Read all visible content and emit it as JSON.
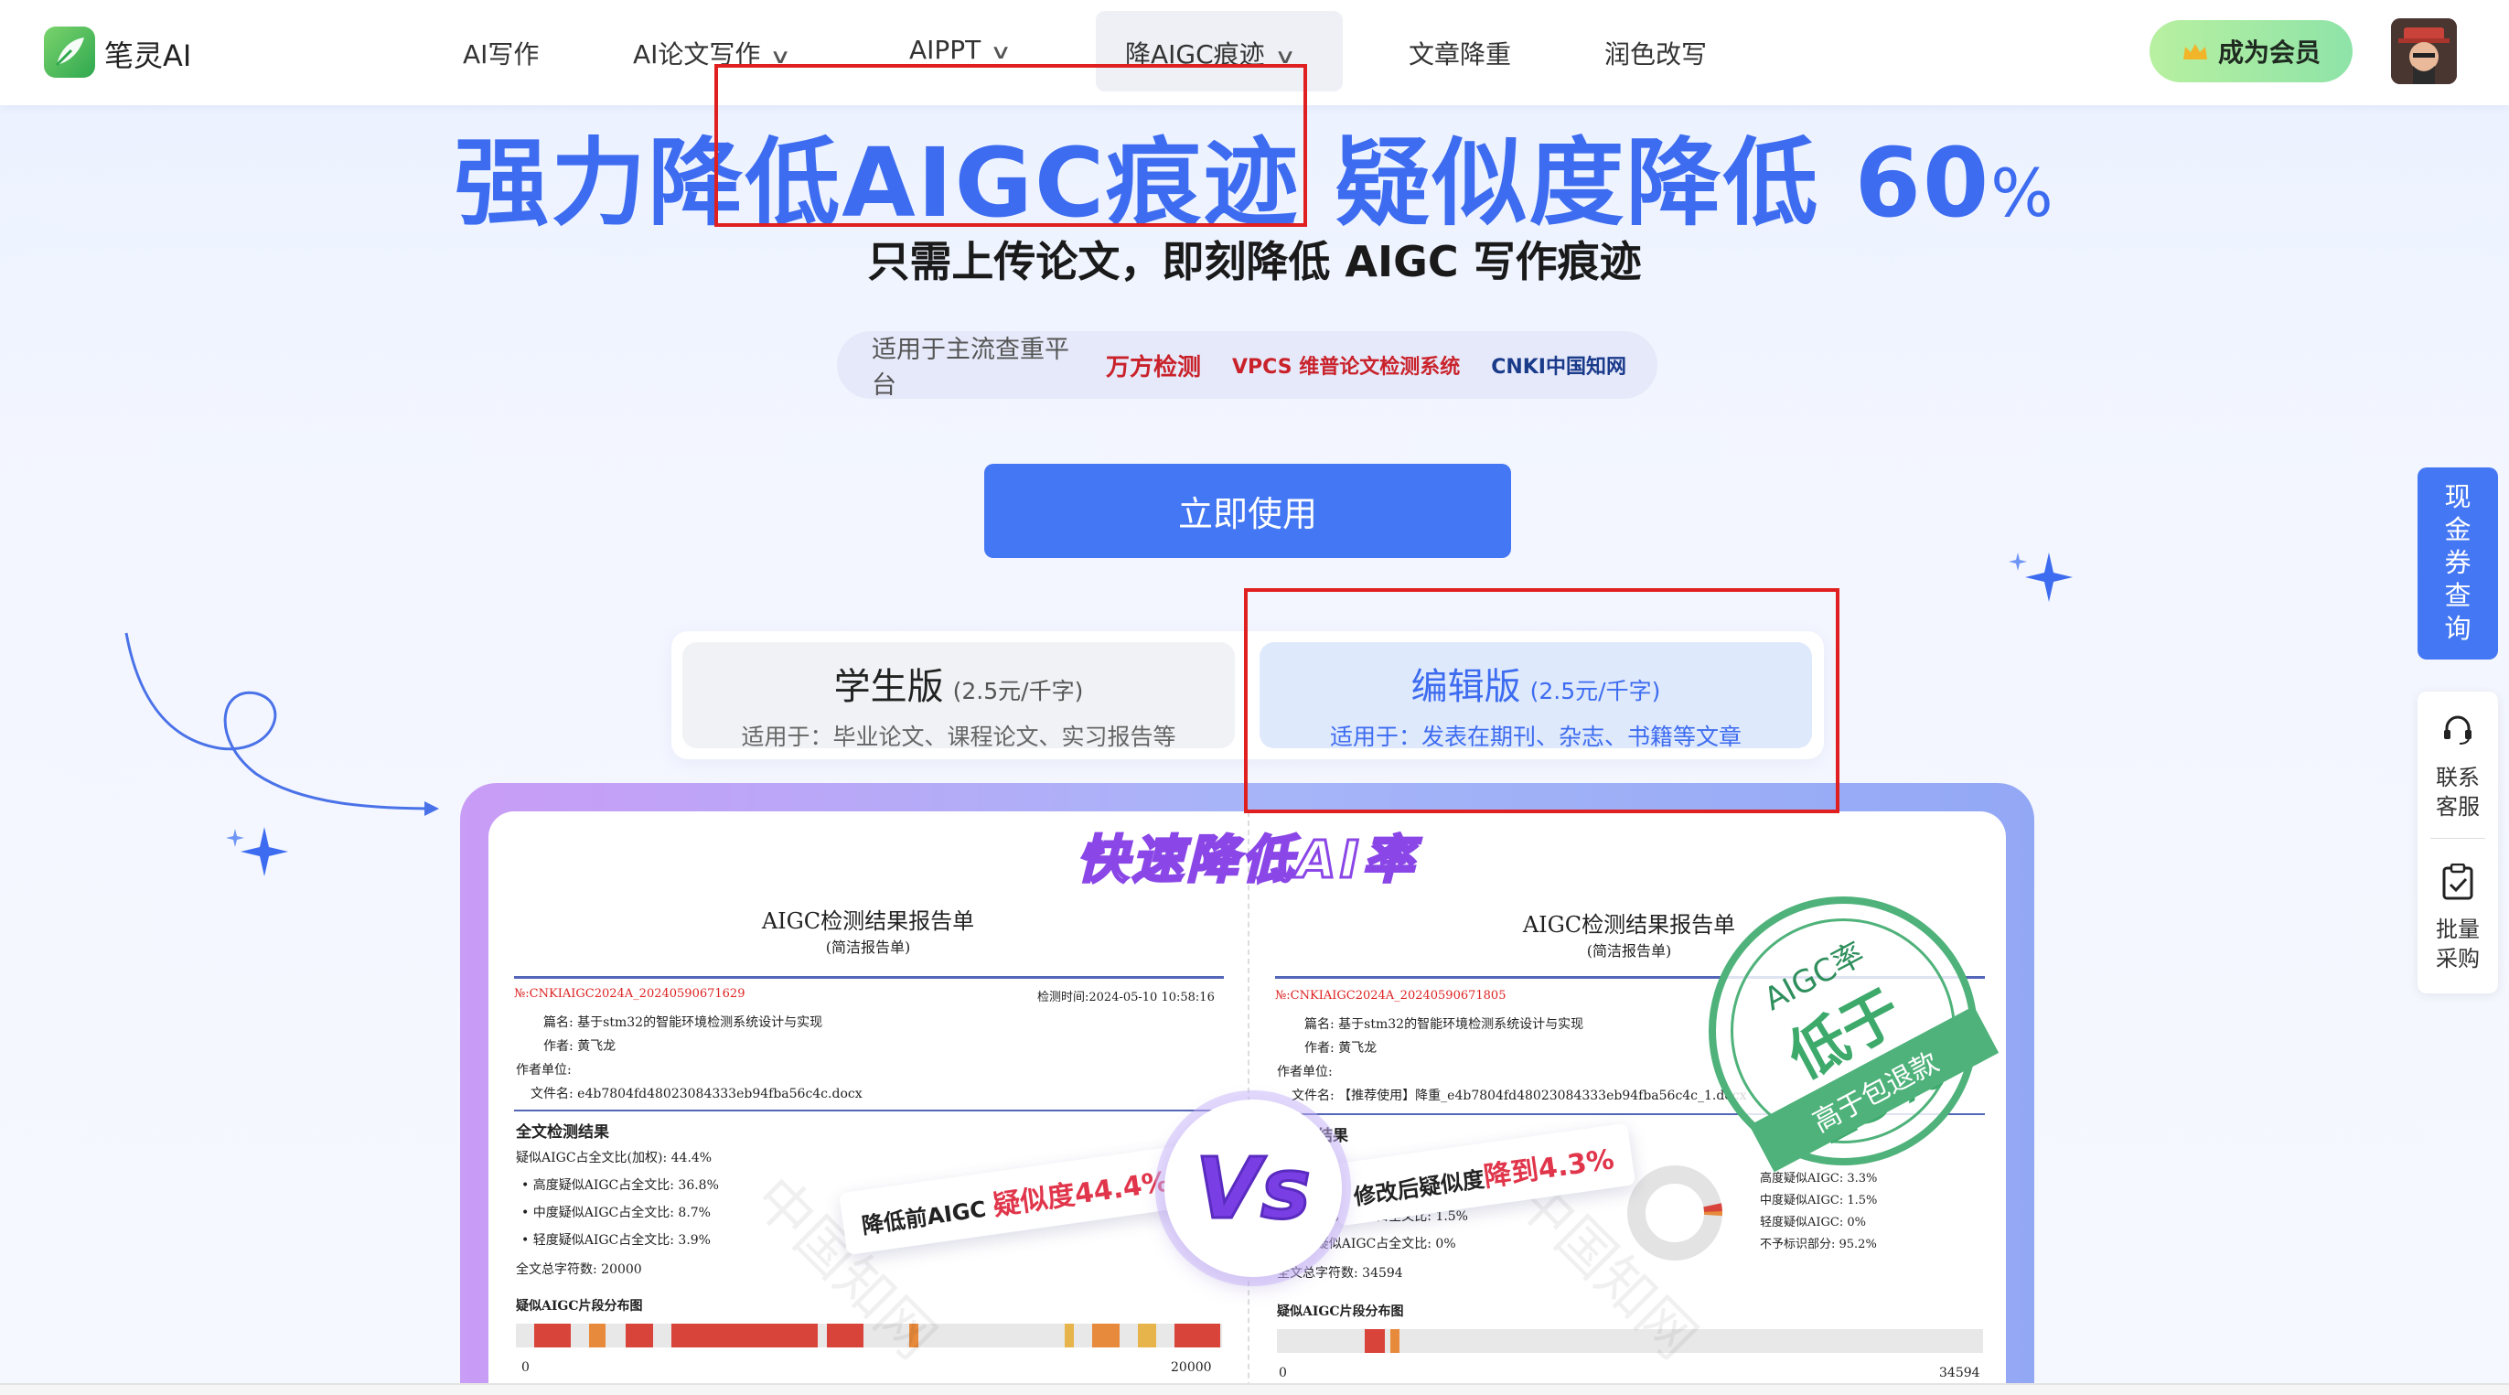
{
  "brand": {
    "name": "笔灵AI"
  },
  "nav": {
    "items": [
      {
        "label": "AI写作",
        "chevron": false
      },
      {
        "label": "AI论文写作",
        "chevron": true
      },
      {
        "label": "AIPPT",
        "chevron": true
      },
      {
        "label": "降AIGC痕迹",
        "chevron": true,
        "active": true
      },
      {
        "label": "文章降重",
        "chevron": false
      },
      {
        "label": "润色改写",
        "chevron": false
      }
    ],
    "member_button": "成为会员"
  },
  "hero": {
    "title_part1": "强力降低AIGC痕迹 疑似度降低 60",
    "title_pct": "%",
    "subtitle": "只需上传论文，即刻降低 AIGC 写作痕迹",
    "platforms_label": "适用于主流查重平台",
    "platforms": [
      "万方检测",
      "VPCS 维普论文检测系统",
      "CNKI中国知网"
    ],
    "cta": "立即使用"
  },
  "versions": [
    {
      "name": "学生版",
      "price": "(2.5元/千字)",
      "desc": "适用于：毕业论文、课程论文、实习报告等",
      "selected": false
    },
    {
      "name": "编辑版",
      "price": "(2.5元/千字)",
      "desc": "适用于：发表在期刊、杂志、书籍等文章",
      "selected": true
    }
  ],
  "showcase": {
    "title": "快速降低AI率",
    "left_report": {
      "title": "AIGC检测结果报告单",
      "subtitle": "(简洁报告单)",
      "no": "№:CNKIAIGC2024A_20240590671629",
      "time": "检测时间:2024-05-10 10:58:16",
      "paper": "篇名: 基于stm32的智能环境检测系统设计与实现",
      "author": "作者: 黄飞龙",
      "unit": "作者单位:",
      "file": "文件名: e4b7804fd48023084333eb94fba56c4c.docx",
      "section": "全文检测结果",
      "lines": [
        "疑似AIGC占全文比(加权): 44.4%",
        "• 高度疑似AIGC占全文比: 36.8%",
        "• 中度疑似AIGC占全文比: 8.7%",
        "• 轻度疑似AIGC占全文比: 3.9%",
        "全文总字符数: 20000"
      ],
      "dist_label": "疑似AIGC片段分布图",
      "axis_start": "0",
      "axis_end": "20000"
    },
    "right_report": {
      "title": "AIGC检测结果报告单",
      "subtitle": "(简洁报告单)",
      "no": "№:CNKIAIGC2024A_20240590671805",
      "paper": "篇名: 基于stm32的智能环境检测系统设计与实现",
      "author": "作者: 黄飞龙",
      "unit": "作者单位:",
      "file": "文件名: 【推荐使用】降重_e4b7804fd48023084333eb94fba56c4c_1.docx",
      "section": "检测结果",
      "lines": [
        "• 轻度疑似AIGC占全文比: 1.5%",
        "• 轻度疑似AIGC占全文比: 0%",
        "全文总字符数: 34594"
      ],
      "legend": [
        "高度疑似AIGC: 3.3%",
        "中度疑似AIGC: 1.5%",
        "轻度疑似AIGC: 0%",
        "不予标识部分: 95.2%"
      ],
      "dist_label": "疑似AIGC片段分布图",
      "axis_start": "0",
      "axis_end": "34594"
    },
    "tag_before": "降低前AIGC",
    "tag_before_value": "疑似度44.4%",
    "tag_after": "修改后疑似度",
    "tag_after_value": "降到4.3%",
    "vs": "Vs",
    "stamp_top": "AIGC率",
    "stamp_mid": "低于15%",
    "stamp_bottom": "高于包退款",
    "watermark": "中国知网"
  },
  "side": {
    "coupon": "现金券查询",
    "service": "联系客服",
    "bulk": "批量采购"
  },
  "colors": {
    "primary": "#4477f3",
    "accent_purple": "#7a3fe4",
    "stamp_green": "#4fb27a",
    "highlight_box": "#e02020"
  }
}
